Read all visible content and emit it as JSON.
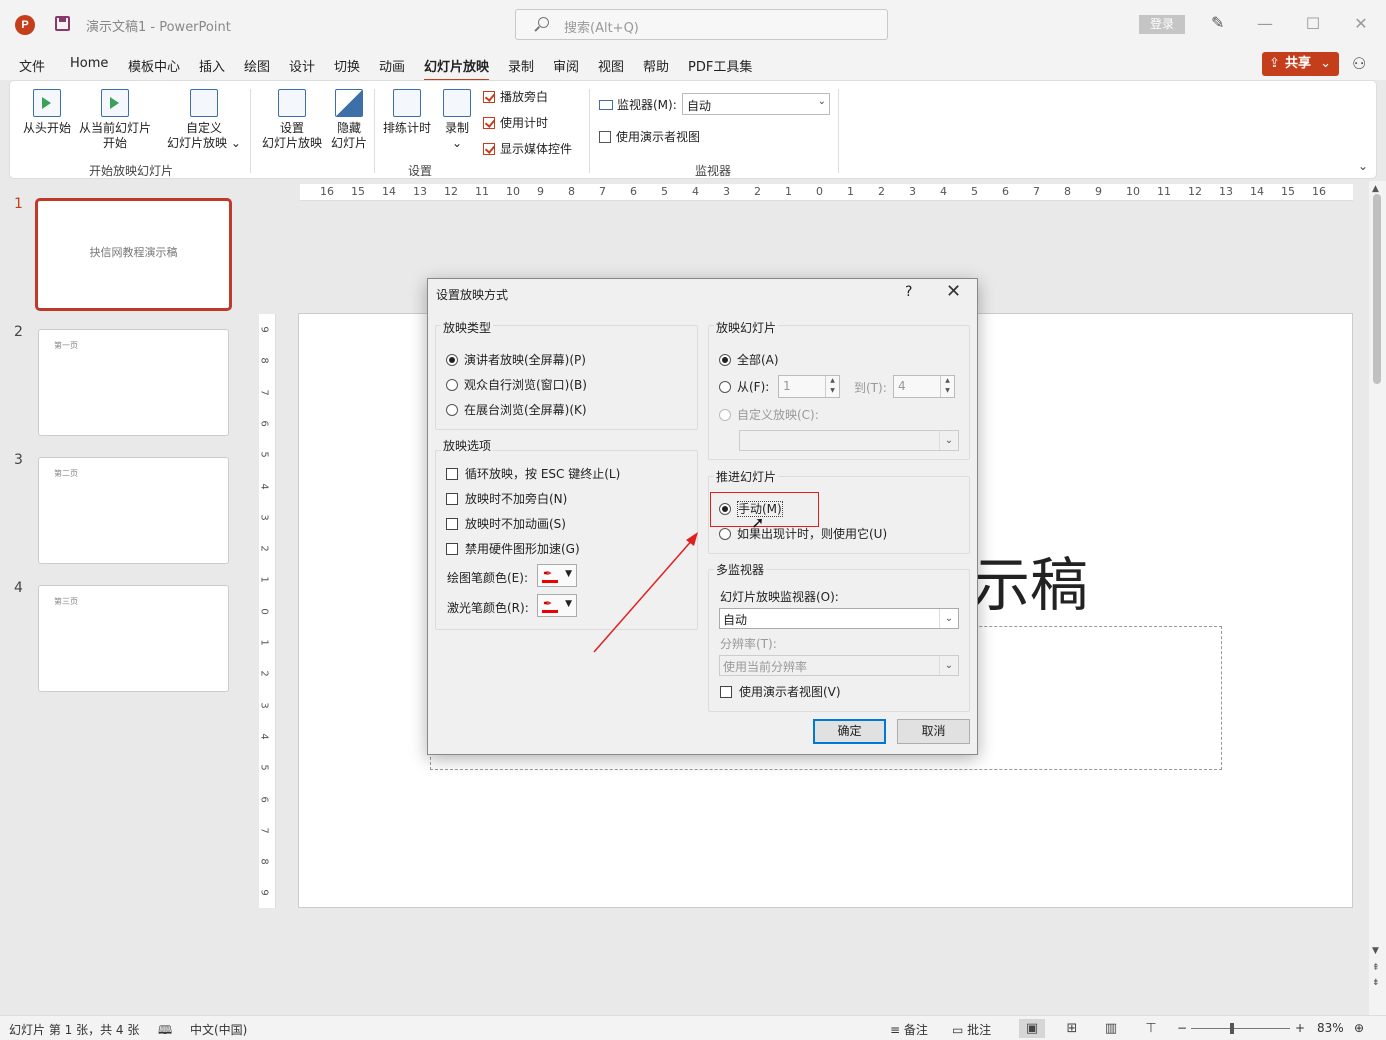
{
  "window": {
    "doc_title": "演示文稿1  -  PowerPoint",
    "logo_letter": "P",
    "search_placeholder": "搜索(Alt+Q)",
    "login_label": "登录",
    "minimize_glyph": "—",
    "maximize_glyph": "☐",
    "close_glyph": "✕"
  },
  "menu": {
    "tabs": [
      "文件",
      "Home",
      "模板中心",
      "插入",
      "绘图",
      "设计",
      "切换",
      "动画",
      "幻灯片放映",
      "录制",
      "审阅",
      "视图",
      "帮助",
      "PDF工具集"
    ],
    "active_tab": "幻灯片放映",
    "share_label": "共享"
  },
  "ribbon": {
    "from_beginning": "从头开始",
    "from_current_line1": "从当前幻灯片",
    "from_current_line2": "开始",
    "custom_line1": "自定义",
    "custom_line2": "幻灯片放映",
    "group_start": "开始放映幻灯片",
    "setup_line1": "设置",
    "setup_line2": "幻灯片放映",
    "hide_line1": "隐藏",
    "hide_line2": "幻灯片",
    "rehearse": "排练计时",
    "record": "录制",
    "play_narrations": "播放旁白",
    "use_timings": "使用计时",
    "show_media_controls": "显示媒体控件",
    "group_setup": "设置",
    "monitor_label": "监视器(M):",
    "monitor_value": "自动",
    "use_presenter_view": "使用演示者视图",
    "group_monitors": "监视器"
  },
  "slides": [
    {
      "num": "1",
      "text": "抉信网教程演示稿"
    },
    {
      "num": "2",
      "text": "第一页"
    },
    {
      "num": "3",
      "text": "第二页"
    },
    {
      "num": "4",
      "text": "第三页"
    }
  ],
  "slide_title_fragment": "示稿",
  "ruler_h": [
    "16",
    "15",
    "14",
    "13",
    "12",
    "11",
    "10",
    "9",
    "8",
    "7",
    "6",
    "5",
    "4",
    "3",
    "2",
    "1",
    "0",
    "1",
    "2",
    "3",
    "4",
    "5",
    "6",
    "7",
    "8",
    "9",
    "10",
    "11",
    "12",
    "13",
    "14",
    "15",
    "16"
  ],
  "ruler_v": [
    "9",
    "8",
    "7",
    "6",
    "5",
    "4",
    "3",
    "2",
    "1",
    "0",
    "1",
    "2",
    "3",
    "4",
    "5",
    "6",
    "7",
    "8",
    "9"
  ],
  "status": {
    "slide_info": "幻灯片 第 1 张，共 4 张",
    "language": "中文(中国)",
    "notes": "备注",
    "comments": "批注",
    "zoom": "83%"
  },
  "dialog": {
    "title": "设置放映方式",
    "help": "?",
    "show_type_legend": "放映类型",
    "show_type_options": [
      "演讲者放映(全屏幕)(P)",
      "观众自行浏览(窗口)(B)",
      "在展台浏览(全屏幕)(K)"
    ],
    "show_options_legend": "放映选项",
    "show_options": [
      "循环放映，按 ESC 键终止(L)",
      "放映时不加旁白(N)",
      "放映时不加动画(S)",
      "禁用硬件图形加速(G)"
    ],
    "pen_color_label": "绘图笔颜色(E):",
    "laser_color_label": "激光笔颜色(R):",
    "show_slides_legend": "放映幻灯片",
    "all_label": "全部(A)",
    "from_label": "从(F):",
    "from_value": "1",
    "to_label": "到(T):",
    "to_value": "4",
    "custom_show_label": "自定义放映(C):",
    "advance_legend": "推进幻灯片",
    "manual_label": "手动(M)",
    "timings_label": "如果出现计时，则使用它(U)",
    "multi_monitor_legend": "多监视器",
    "slide_monitor_label": "幻灯片放映监视器(O):",
    "slide_monitor_value": "自动",
    "resolution_label": "分辨率(T):",
    "resolution_value": "使用当前分辨率",
    "presenter_view_label": "使用演示者视图(V)",
    "ok_label": "确定",
    "cancel_label": "取消"
  },
  "colors": {
    "accent": "#c43e1c",
    "highlight_box": "#e02020",
    "arrow": "#e02020"
  }
}
